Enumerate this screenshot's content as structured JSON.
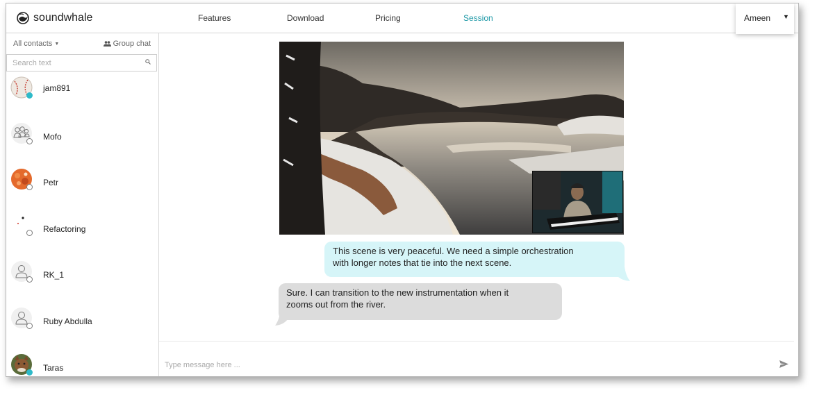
{
  "app": {
    "brand": "soundwhale",
    "logo_icon": "whale-logo-icon"
  },
  "nav": {
    "items": [
      {
        "label": "Features"
      },
      {
        "label": "Download"
      },
      {
        "label": "Pricing"
      },
      {
        "label": "Session",
        "active": true
      }
    ],
    "accent_color": "#1c98a6"
  },
  "user_menu": {
    "name": "Ameen",
    "icon": "caret-down-icon"
  },
  "sidebar": {
    "filter_label": "All contacts",
    "filter_icon": "caret-down-icon",
    "group_chat_label": "Group chat",
    "group_chat_icon": "group-icon",
    "search": {
      "placeholder": "Search text",
      "icon": "search-icon"
    },
    "contacts": [
      {
        "name": "jam891",
        "avatar": "baseball-photo",
        "status": "online"
      },
      {
        "name": "Mofo",
        "avatar": "group-placeholder-icon",
        "status": "offline"
      },
      {
        "name": "Petr",
        "avatar": "orange-photo",
        "status": "offline"
      },
      {
        "name": "Refactoring",
        "avatar": "small-dots-image",
        "status": "offline"
      },
      {
        "name": "RK_1",
        "avatar": "user-placeholder-icon",
        "status": "offline"
      },
      {
        "name": "Ruby Abdulla",
        "avatar": "user-placeholder-icon",
        "status": "offline"
      },
      {
        "name": "Taras",
        "avatar": "cat-photo",
        "status": "online"
      }
    ],
    "online_color": "#2ebac9"
  },
  "chat": {
    "video": {
      "scene": "winter-river-video",
      "pip": "musician-webcam-pip"
    },
    "messages": [
      {
        "direction": "out",
        "text_line1": "This scene is very peaceful. We need a simple orchestration",
        "text_line2": "with longer notes that tie into the next scene.",
        "color": "#d6f5f8"
      },
      {
        "direction": "in",
        "text_line1": "Sure. I can transition to the new instrumentation when it",
        "text_line2": "zooms out from the river.",
        "color": "#dcdcdc"
      }
    ],
    "composer": {
      "placeholder": "Type message here ...",
      "send_icon": "send-icon"
    }
  }
}
